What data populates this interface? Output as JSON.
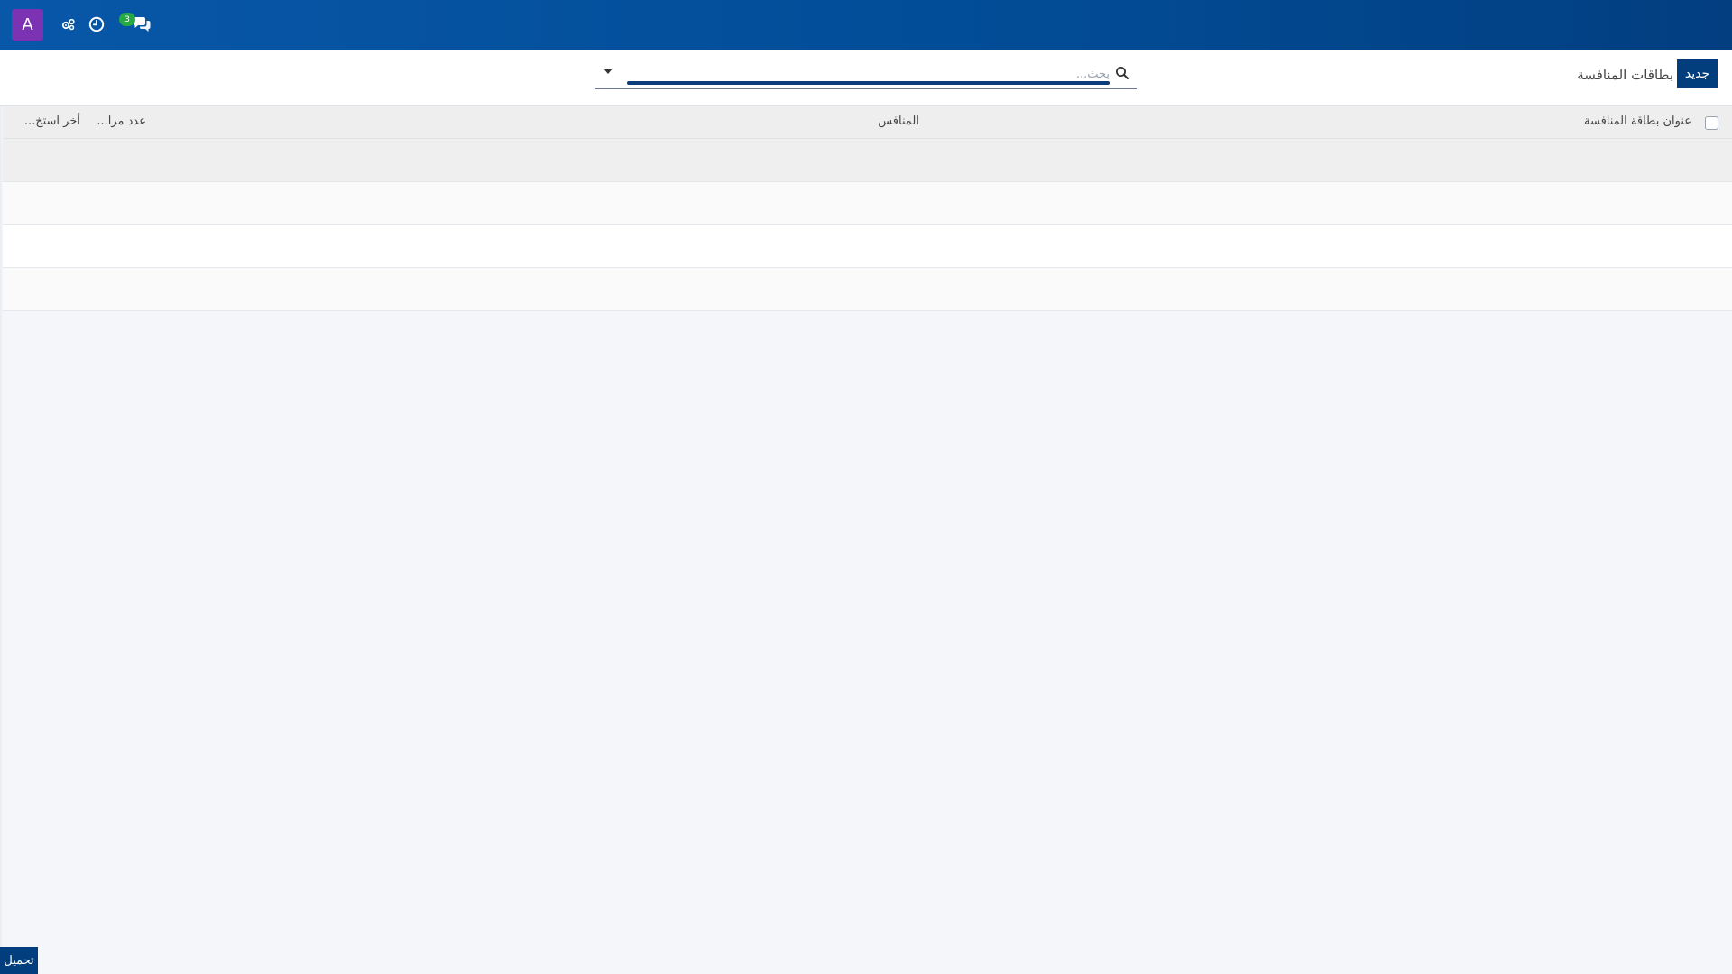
{
  "topbar": {
    "avatar_letter": "A",
    "icons": [
      "settings-users-icon",
      "clock-icon",
      "chat-icon"
    ],
    "chat_badge_count": "3",
    "colors": {
      "bar": "#024c96",
      "avatar": "#7b33b3",
      "badge": "#27a745"
    }
  },
  "control_panel": {
    "new_button_label": "جديد",
    "breadcrumb": "بطاقات المنافسة",
    "search_placeholder": "بحث..."
  },
  "table": {
    "headers": {
      "title": "عنوان بطاقة المنافسة",
      "competitor": "المنافس",
      "count": "عدد مرا...",
      "last_used": "أخر استخ..."
    },
    "rows": [
      {
        "title": "",
        "competitor": "",
        "count": "",
        "last_used": ""
      },
      {
        "title": "",
        "competitor": "",
        "count": "",
        "last_used": ""
      },
      {
        "title": "",
        "competitor": "",
        "count": "",
        "last_used": ""
      },
      {
        "title": "",
        "competitor": "",
        "count": "",
        "last_used": ""
      }
    ]
  },
  "footer": {
    "load_button_label": "تحميل"
  }
}
